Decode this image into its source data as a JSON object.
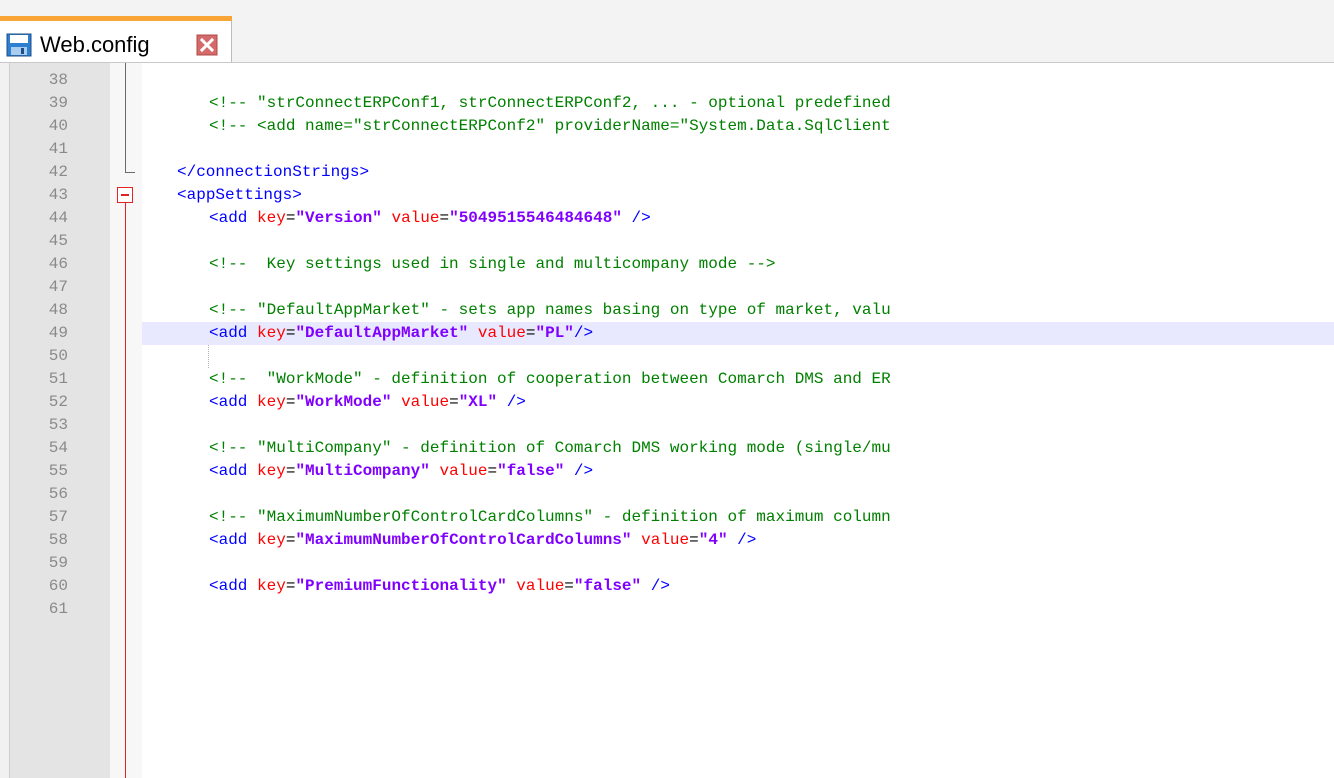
{
  "tab": {
    "title": "Web.config",
    "save_icon": "save-icon",
    "close_icon": "close-icon"
  },
  "colors": {
    "comment": "#008000",
    "tag": "#0000ff",
    "attribute": "#ff0000",
    "value": "#8000ff",
    "fold_marker": "#e02424",
    "tab_accent": "#f9a436",
    "current_line": "#e8e8ff"
  },
  "editor": {
    "current_line": "49",
    "lines": [
      {
        "num": "38",
        "text": ""
      },
      {
        "num": "39",
        "text": "<!-- \"strConnectERPConf1, strConnectERPConf2, ... - optional predefined"
      },
      {
        "num": "40",
        "text": "<!-- <add name=\"strConnectERPConf2\" providerName=\"System.Data.SqlClient"
      },
      {
        "num": "41",
        "text": ""
      },
      {
        "num": "42",
        "tag_open": "</",
        "tag_name": "connectionStrings",
        "tag_close": ">"
      },
      {
        "num": "43",
        "tag_open": "<",
        "tag_name": "appSettings",
        "tag_close": ">"
      },
      {
        "num": "44",
        "tag_open": "<add ",
        "attr1": "key",
        "eq1": "=",
        "val1": "\"Version\"",
        "attr2": "value",
        "eq2": "=",
        "val2": "\"5049515546484648\"",
        "tag_close": " />"
      },
      {
        "num": "45",
        "text": ""
      },
      {
        "num": "46",
        "text": "<!--  Key settings used in single and multicompany mode -->"
      },
      {
        "num": "47",
        "text": ""
      },
      {
        "num": "48",
        "text": "<!-- \"DefaultAppMarket\" - sets app names basing on type of market, valu"
      },
      {
        "num": "49",
        "tag_open": "<add ",
        "attr1": "key",
        "eq1": "=",
        "val1": "\"DefaultAppMarket\"",
        "attr2": "value",
        "eq2": "=",
        "val2": "\"PL\"",
        "tag_close": "/>"
      },
      {
        "num": "50",
        "text": ""
      },
      {
        "num": "51",
        "text": "<!--  \"WorkMode\" - definition of cooperation between Comarch DMS and ER"
      },
      {
        "num": "52",
        "tag_open": "<add ",
        "attr1": "key",
        "eq1": "=",
        "val1": "\"WorkMode\"",
        "attr2": "value",
        "eq2": "=",
        "val2": "\"XL\"",
        "tag_close": " />"
      },
      {
        "num": "53",
        "text": ""
      },
      {
        "num": "54",
        "text": "<!-- \"MultiCompany\" - definition of Comarch DMS working mode (single/mu"
      },
      {
        "num": "55",
        "tag_open": "<add ",
        "attr1": "key",
        "eq1": "=",
        "val1": "\"MultiCompany\"",
        "attr2": "value",
        "eq2": "=",
        "val2": "\"false\"",
        "tag_close": " />"
      },
      {
        "num": "56",
        "text": ""
      },
      {
        "num": "57",
        "text": "<!-- \"MaximumNumberOfControlCardColumns\" - definition of maximum column"
      },
      {
        "num": "58",
        "tag_open": "<add ",
        "attr1": "key",
        "eq1": "=",
        "val1": "\"MaximumNumberOfControlCardColumns\"",
        "attr2": "value",
        "eq2": "=",
        "val2": "\"4\"",
        "tag_close": " />"
      },
      {
        "num": "59",
        "text": ""
      },
      {
        "num": "60",
        "tag_open": "<add ",
        "attr1": "key",
        "eq1": "=",
        "val1": "\"PremiumFunctionality\"",
        "attr2": "value",
        "eq2": "=",
        "val2": "\"false\"",
        "tag_close": " />"
      },
      {
        "num": "61",
        "text": ""
      }
    ]
  }
}
